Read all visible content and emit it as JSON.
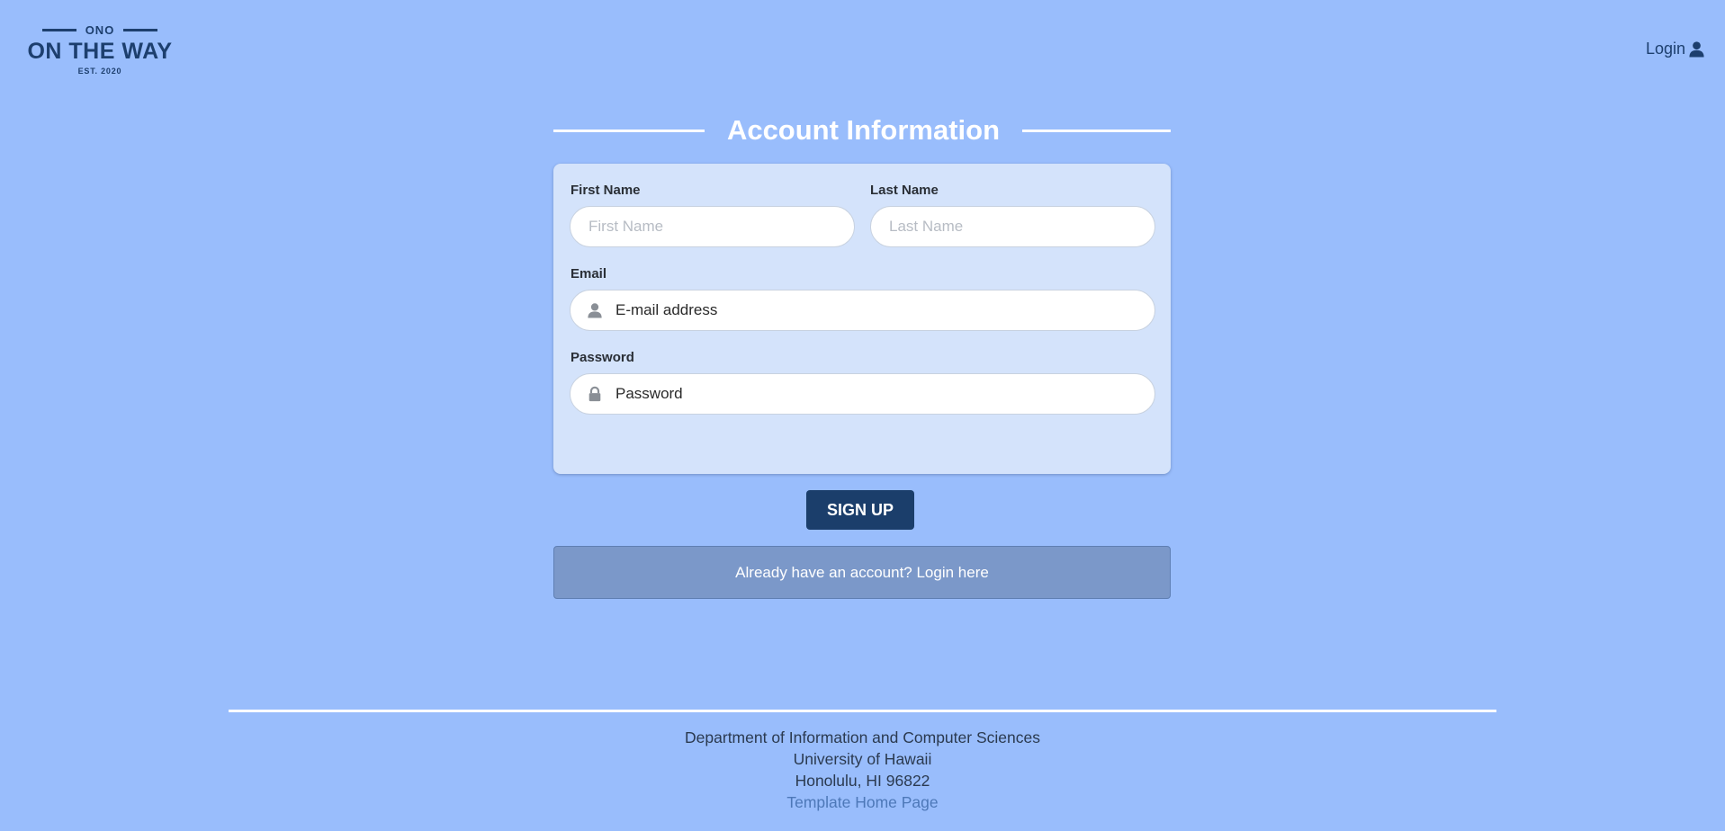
{
  "logo": {
    "top": "ONO",
    "main": "ON THE WAY",
    "est": "EST. 2020"
  },
  "nav": {
    "login_label": "Login",
    "login_icon": "user-icon"
  },
  "form": {
    "title": "Account Information",
    "first_name_label": "First Name",
    "first_name_placeholder": "First Name",
    "first_name_value": "",
    "last_name_label": "Last Name",
    "last_name_placeholder": "Last Name",
    "last_name_value": "",
    "email_label": "Email",
    "email_placeholder": "E-mail address",
    "email_value": "",
    "email_icon": "user-icon",
    "password_label": "Password",
    "password_placeholder": "Password",
    "password_value": "",
    "password_icon": "lock-icon",
    "submit_label": "SIGN UP",
    "login_prompt": "Already have an account? Login here"
  },
  "footer": {
    "line1": "Department of Information and Computer Sciences",
    "line2": "University of Hawaii",
    "line3": "Honolulu, HI 96822",
    "link": "Template Home Page"
  },
  "colors": {
    "background": "#99bdfc",
    "card": "#d4e3fb",
    "primary": "#1b3e6b",
    "secondary_box": "#7b98c9",
    "link": "#4d78b8"
  }
}
